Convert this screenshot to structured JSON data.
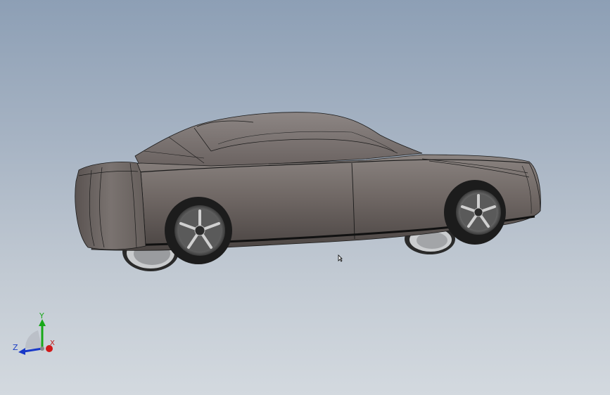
{
  "triad": {
    "x_label": "X",
    "y_label": "Y",
    "z_label": "Z",
    "x_color": "#d01818",
    "y_color": "#18a818",
    "z_color": "#1838c8"
  },
  "colors": {
    "body": "#6e6663",
    "background_top": "#8d9fb5",
    "background_bottom": "#d3d9df"
  },
  "icons": {
    "cursor": "arrow-cursor-icon"
  }
}
